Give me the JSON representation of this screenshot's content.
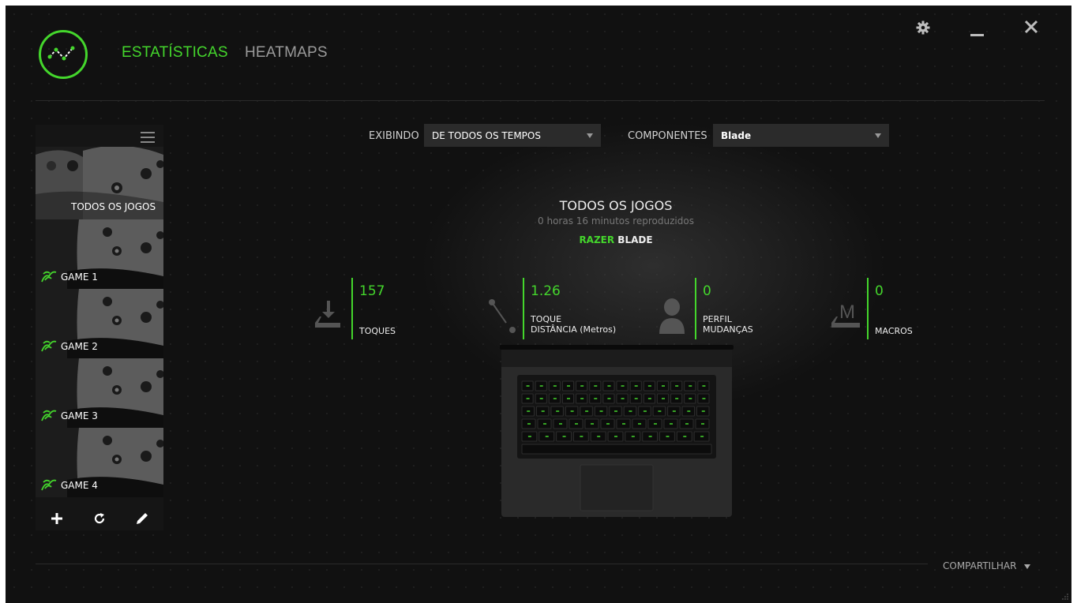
{
  "header": {
    "tabs": [
      {
        "label": "ESTATÍSTICAS",
        "active": true
      },
      {
        "label": "HEATMAPS",
        "active": false
      }
    ],
    "window_controls": [
      "gear-icon",
      "minimize-icon",
      "close-icon"
    ]
  },
  "sidebar": {
    "games": [
      {
        "label": "TODOS OS JOGOS",
        "active": true,
        "razer_icon": false
      },
      {
        "label": "GAME 1",
        "active": false,
        "razer_icon": true
      },
      {
        "label": "GAME 2",
        "active": false,
        "razer_icon": true
      },
      {
        "label": "GAME 3",
        "active": false,
        "razer_icon": true
      },
      {
        "label": "GAME 4",
        "active": false,
        "razer_icon": true
      }
    ],
    "tools": [
      "add-icon",
      "refresh-icon",
      "edit-icon"
    ]
  },
  "filters": {
    "showing_label": "EXIBINDO",
    "showing_value": "DE TODOS OS TEMPOS",
    "components_label": "COMPONENTES",
    "components_value": "Blade"
  },
  "summary": {
    "title": "TODOS OS JOGOS",
    "playtime": "0 horas 16 minutos reproduzidos",
    "brand": "RAZER",
    "device": "BLADE"
  },
  "stats": [
    {
      "icon": "keypress-icon",
      "value": "157",
      "label_line1": "TOQUES",
      "label_line2": ""
    },
    {
      "icon": "distance-icon",
      "value": "1.26",
      "label_line1": "TOQUE",
      "label_line2": "DISTÂNCIA (Metros)"
    },
    {
      "icon": "profile-icon",
      "value": "0",
      "label_line1": "PERFIL",
      "label_line2": "MUDANÇAS"
    },
    {
      "icon": "macro-icon",
      "value": "0",
      "label_line1": "",
      "label_line2": "MACROS"
    }
  ],
  "footer": {
    "share_label": "COMPARTILHAR"
  },
  "colors": {
    "accent": "#44d62c",
    "background": "#111111"
  }
}
